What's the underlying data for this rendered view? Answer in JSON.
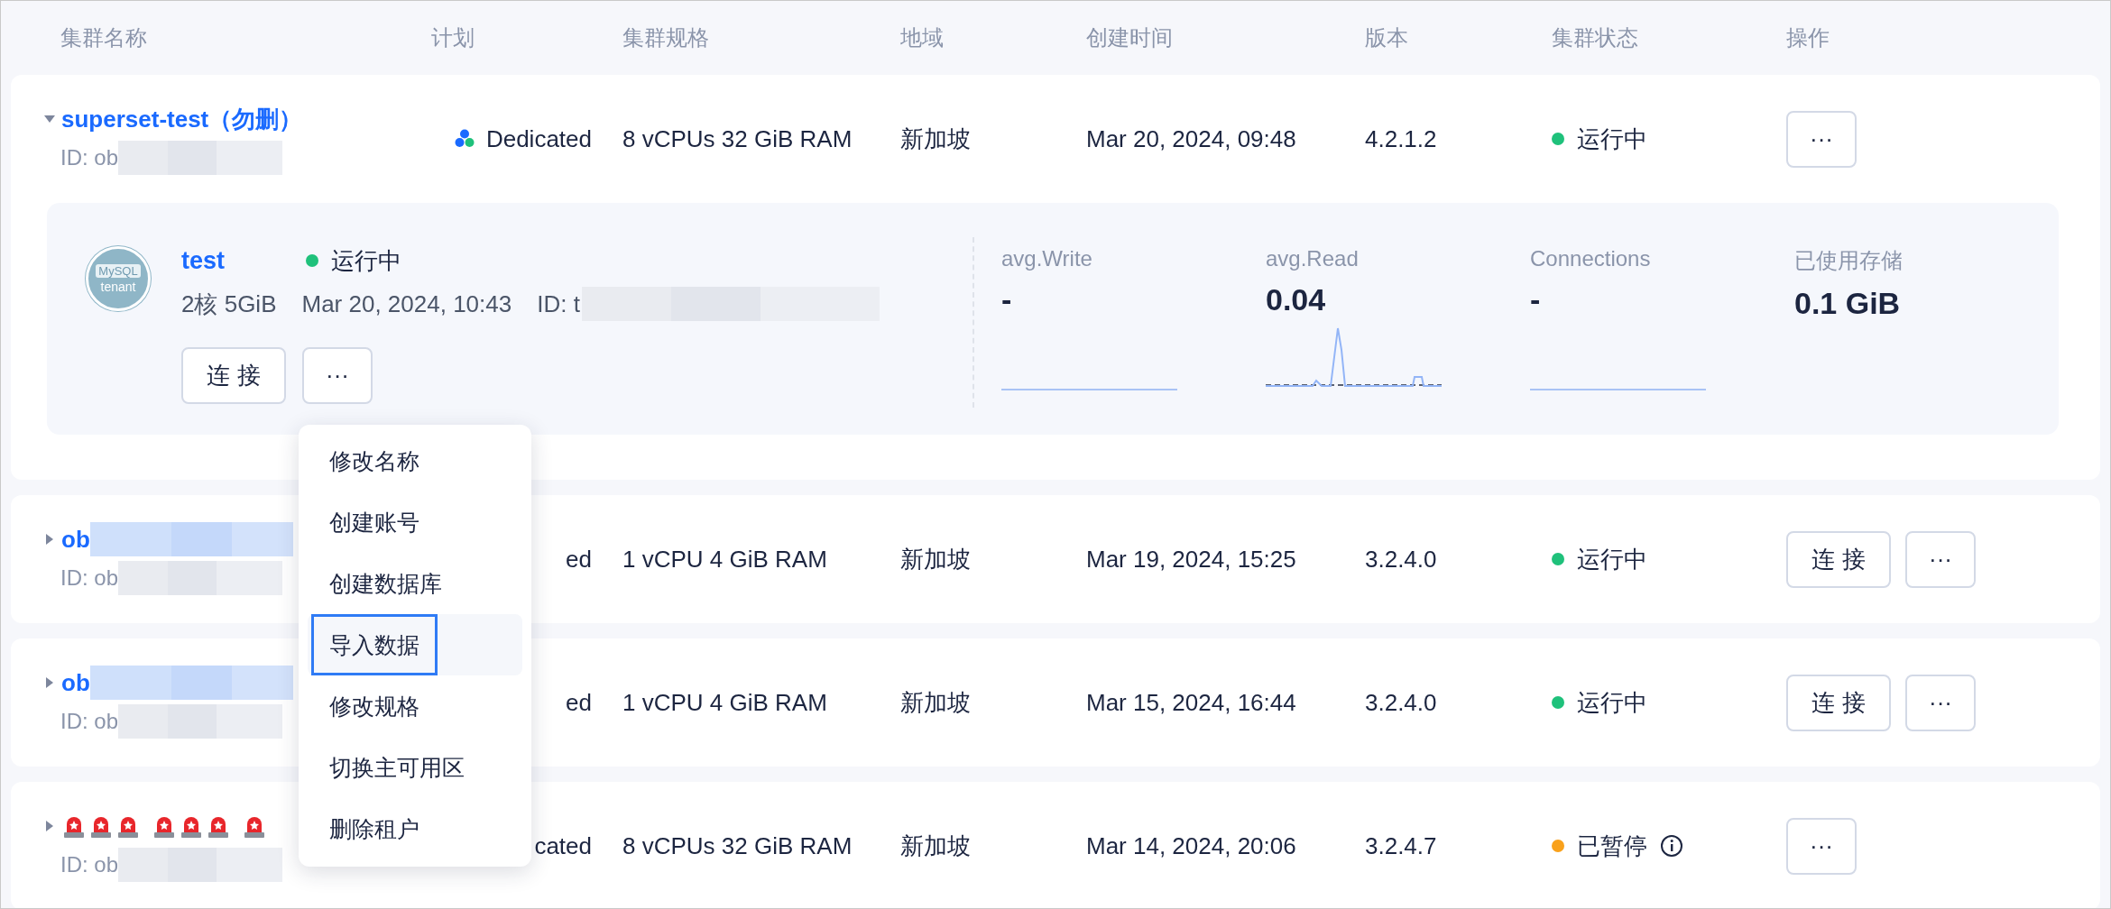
{
  "columns": [
    "集群名称",
    "计划",
    "集群规格",
    "地域",
    "创建时间",
    "版本",
    "集群状态",
    "操作"
  ],
  "clusters": [
    {
      "expanded": true,
      "name": "superset-test（勿删）",
      "name_masked": false,
      "id": "ID: ob",
      "id_masked": true,
      "plan_icon": true,
      "plan": "Dedicated",
      "spec": "8 vCPUs 32 GiB RAM",
      "region": "新加坡",
      "created": "Mar 20, 2024, 09:48",
      "version": "4.2.1.2",
      "status": {
        "text": "运行中",
        "color": "#1fc17b",
        "info": false
      },
      "actions": [
        {
          "kind": "more",
          "label": "···"
        }
      ],
      "tenants": [
        {
          "avatar": [
            "MySQL",
            "tenant"
          ],
          "name": "test",
          "status": {
            "text": "运行中",
            "color": "#1fc17b"
          },
          "spec": "2核 5GiB",
          "created": "Mar 20, 2024, 10:43",
          "id": "ID: t",
          "id_masked": true,
          "actions": [
            {
              "kind": "connect",
              "label": "连 接"
            },
            {
              "kind": "more",
              "label": "···"
            }
          ],
          "metrics": [
            {
              "kind": "flat",
              "label": "avg.Write",
              "value": "-"
            },
            {
              "kind": "spike",
              "label": "avg.Read",
              "value": "0.04"
            },
            {
              "kind": "flat",
              "label": "Connections",
              "value": "-"
            },
            {
              "kind": "plain",
              "label": "已使用存储",
              "value": "0.1 GiB"
            }
          ]
        }
      ]
    },
    {
      "expanded": false,
      "name": "ob",
      "name_masked": true,
      "id": "ID: ob",
      "id_masked": true,
      "plan_icon": false,
      "plan": "ed",
      "spec": "1 vCPU 4 GiB RAM",
      "region": "新加坡",
      "created": "Mar 19, 2024, 15:25",
      "version": "3.2.4.0",
      "status": {
        "text": "运行中",
        "color": "#1fc17b",
        "info": false
      },
      "actions": [
        {
          "kind": "connect",
          "label": "连 接"
        },
        {
          "kind": "more",
          "label": "···"
        }
      ]
    },
    {
      "expanded": false,
      "name": "ob",
      "name_masked": true,
      "id": "ID: ob",
      "id_masked": true,
      "plan_icon": false,
      "plan": "ed",
      "spec": "1 vCPU 4 GiB RAM",
      "region": "新加坡",
      "created": "Mar 15, 2024, 16:44",
      "version": "3.2.4.0",
      "status": {
        "text": "运行中",
        "color": "#1fc17b",
        "info": false
      },
      "actions": [
        {
          "kind": "connect",
          "label": "连 接"
        },
        {
          "kind": "more",
          "label": "···"
        }
      ]
    },
    {
      "expanded": false,
      "name_icons": [
        [
          {
            "kind": "siren"
          },
          {
            "kind": "siren"
          },
          {
            "kind": "siren"
          }
        ],
        [
          {
            "kind": "siren"
          },
          {
            "kind": "siren"
          },
          {
            "kind": "siren"
          }
        ],
        [
          {
            "kind": "siren"
          }
        ]
      ],
      "id": "ID: ob",
      "id_masked": true,
      "plan_icon": false,
      "plan": "cated",
      "spec": "8 vCPUs 32 GiB RAM",
      "region": "新加坡",
      "created": "Mar 14, 2024, 20:06",
      "version": "3.2.4.7",
      "status": {
        "text": "已暂停",
        "color": "#f9a11b",
        "info": true
      },
      "actions": [
        {
          "kind": "more",
          "label": "···"
        }
      ]
    }
  ],
  "menu": {
    "items": [
      {
        "label": "修改名称",
        "selected": false
      },
      {
        "label": "创建账号",
        "selected": false
      },
      {
        "label": "创建数据库",
        "selected": false
      },
      {
        "label": "导入数据",
        "selected": true
      },
      {
        "label": "修改规格",
        "selected": false
      },
      {
        "label": "切换主可用区",
        "selected": false
      },
      {
        "label": "删除租户",
        "selected": false
      }
    ]
  }
}
